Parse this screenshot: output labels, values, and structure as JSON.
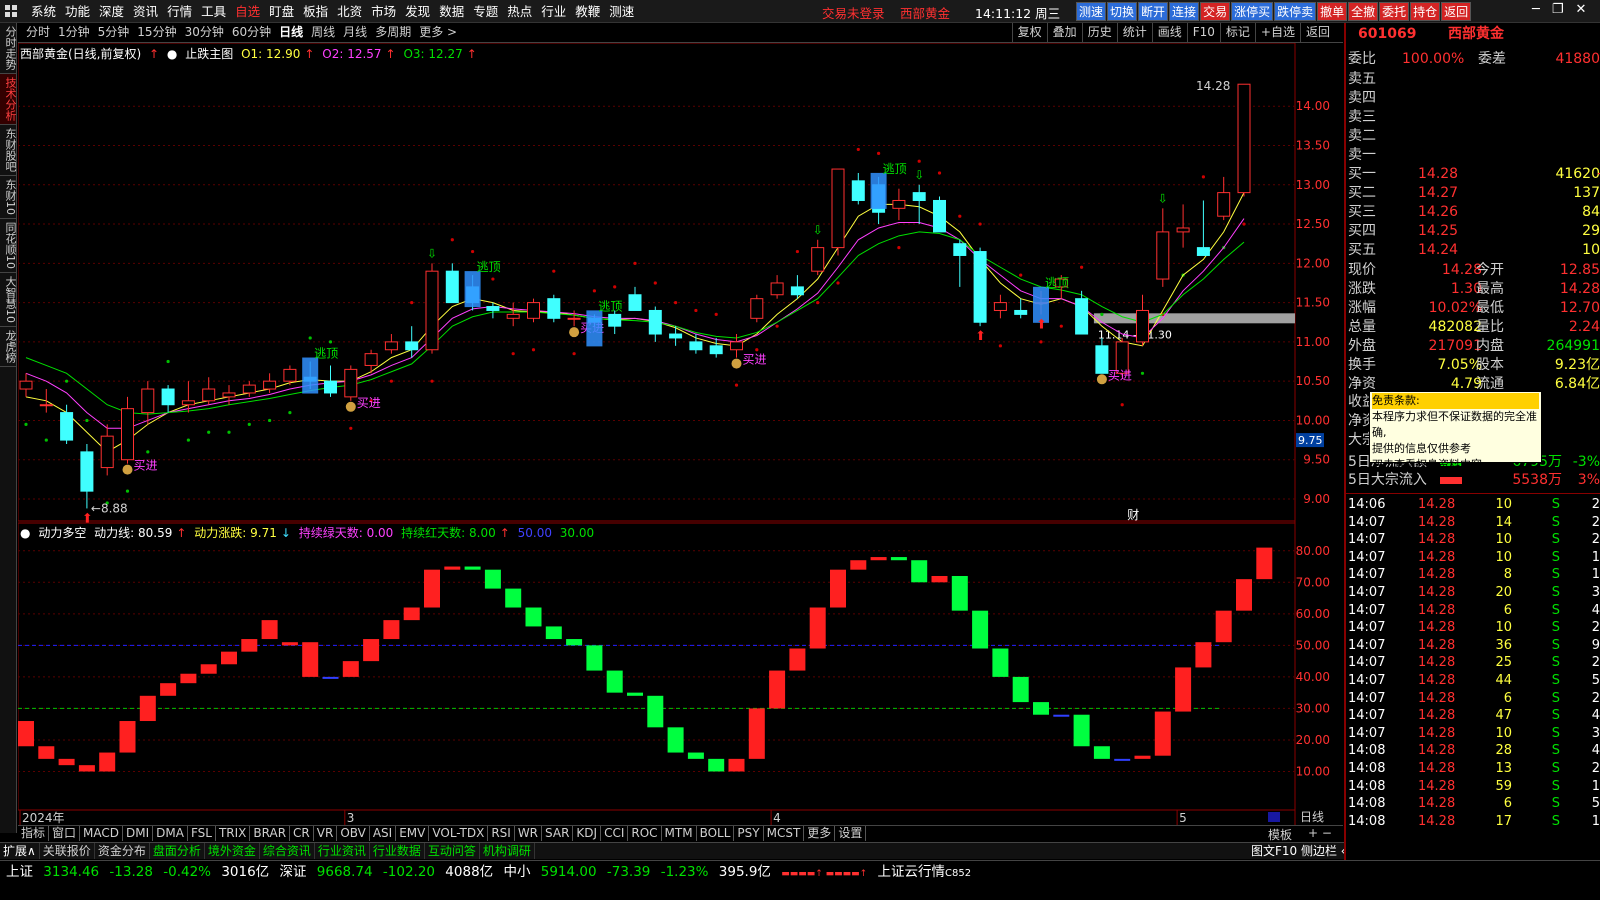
{
  "menu": {
    "items": [
      "系统",
      "功能",
      "深度",
      "资讯",
      "行情",
      "工具",
      "自选",
      "盯盘",
      "板指",
      "北资",
      "市场",
      "发现",
      "数据",
      "专题",
      "热点",
      "行业",
      "教鞭",
      "测速"
    ],
    "active": "自选",
    "login_status": "交易未登录",
    "stock_name_top": "西部黄金",
    "time": "14:11:12",
    "weekday": "周三",
    "quick_buttons": [
      {
        "label": "测速",
        "c": "blue"
      },
      {
        "label": "切换",
        "c": "blue"
      },
      {
        "label": "断开",
        "c": "blue"
      },
      {
        "label": "连接",
        "c": "blue"
      },
      {
        "label": "交易",
        "c": "red"
      },
      {
        "label": "涨停买",
        "c": "blue"
      },
      {
        "label": "跌停卖",
        "c": "blue"
      },
      {
        "label": "撤单",
        "c": "red"
      },
      {
        "label": "全撤",
        "c": "red"
      },
      {
        "label": "委托",
        "c": "red"
      },
      {
        "label": "持仓",
        "c": "red"
      },
      {
        "label": "返回",
        "c": "red"
      }
    ]
  },
  "left_tabs": [
    {
      "label": "分时走势",
      "active": false
    },
    {
      "label": "技术分析",
      "active": true
    },
    {
      "label": "东财股吧",
      "active": false
    },
    {
      "label": "东财10",
      "active": false
    },
    {
      "label": "同花顺10",
      "active": false
    },
    {
      "label": "大智慧10",
      "active": false
    },
    {
      "label": "龙虎榜",
      "active": false
    }
  ],
  "period_bar": {
    "periods": [
      "分时",
      "1分钟",
      "5分钟",
      "15分钟",
      "30分钟",
      "60分钟",
      "日线",
      "周线",
      "月线",
      "多周期",
      "更多 >"
    ],
    "active": "日线",
    "tools": [
      "复权",
      "叠加",
      "历史",
      "统计",
      "画线",
      "F10",
      "标记",
      "+自选",
      "返回"
    ]
  },
  "main_chart_title": {
    "name": "西部黄金(日线,前复权)",
    "indicator": "止跌主图",
    "o1": "O1: 12.90",
    "o2": "O2: 12.57",
    "o3": "O3: 12.27"
  },
  "indicator_title": {
    "name": "动力多空",
    "l1": "动力线: 80.59",
    "l2": "动力涨跌: 9.71",
    "l3": "持续绿天数: 0.00",
    "l4": "持续红天数: 8.00",
    "l5": "50.00",
    "l6": "30.00"
  },
  "chart_data": {
    "type": "candlestick",
    "price_axis": {
      "min": 9.0,
      "max": 14.0,
      "ticks": [
        "14.00",
        "13.50",
        "13.00",
        "12.50",
        "12.00",
        "11.50",
        "11.00",
        "10.50",
        "10.00",
        "9.50",
        "9.00"
      ]
    },
    "x_labels": [
      {
        "label": "2024年",
        "i": 0
      },
      {
        "label": "3",
        "i": 16
      },
      {
        "label": "4",
        "i": 37
      },
      {
        "label": "5",
        "i": 57
      }
    ],
    "candles": [
      [
        10.4,
        10.6,
        10.3,
        10.5
      ],
      [
        10.2,
        10.4,
        10.1,
        10.2
      ],
      [
        10.1,
        10.2,
        9.7,
        9.75
      ],
      [
        9.6,
        9.7,
        8.88,
        9.1
      ],
      [
        9.4,
        9.95,
        9.3,
        9.8
      ],
      [
        9.5,
        10.3,
        9.45,
        10.15
      ],
      [
        10.1,
        10.5,
        9.95,
        10.4
      ],
      [
        10.4,
        10.45,
        10.1,
        10.2
      ],
      [
        10.2,
        10.5,
        10.1,
        10.25
      ],
      [
        10.25,
        10.55,
        10.2,
        10.4
      ],
      [
        10.3,
        10.45,
        10.2,
        10.35
      ],
      [
        10.35,
        10.5,
        10.3,
        10.45
      ],
      [
        10.4,
        10.6,
        10.35,
        10.5
      ],
      [
        10.5,
        10.7,
        10.45,
        10.65
      ],
      [
        10.55,
        10.75,
        10.4,
        10.5
      ],
      [
        10.5,
        10.7,
        10.3,
        10.35
      ],
      [
        10.3,
        10.7,
        10.25,
        10.65
      ],
      [
        10.7,
        10.9,
        10.6,
        10.85
      ],
      [
        10.9,
        11.1,
        10.85,
        11.0
      ],
      [
        11.0,
        11.2,
        10.8,
        10.9
      ],
      [
        10.9,
        12.0,
        10.85,
        11.9
      ],
      [
        11.9,
        12.0,
        11.5,
        11.5
      ],
      [
        11.7,
        11.85,
        11.4,
        11.5
      ],
      [
        11.45,
        11.5,
        11.3,
        11.4
      ],
      [
        11.3,
        11.5,
        11.2,
        11.35
      ],
      [
        11.3,
        11.55,
        11.25,
        11.5
      ],
      [
        11.55,
        11.6,
        11.25,
        11.3
      ],
      [
        11.3,
        11.4,
        11.2,
        11.3
      ],
      [
        11.3,
        11.35,
        11.2,
        11.25
      ],
      [
        11.35,
        11.4,
        11.1,
        11.2
      ],
      [
        11.6,
        11.7,
        11.4,
        11.4
      ],
      [
        11.4,
        11.45,
        11.0,
        11.1
      ],
      [
        11.1,
        11.2,
        10.95,
        11.05
      ],
      [
        11.0,
        11.1,
        10.85,
        10.9
      ],
      [
        10.95,
        11.05,
        10.8,
        10.85
      ],
      [
        10.9,
        11.1,
        10.8,
        11.0
      ],
      [
        11.3,
        11.6,
        11.25,
        11.55
      ],
      [
        11.6,
        11.85,
        11.55,
        11.75
      ],
      [
        11.7,
        11.85,
        11.55,
        11.6
      ],
      [
        11.9,
        12.3,
        11.85,
        12.2
      ],
      [
        12.2,
        13.2,
        12.1,
        13.2
      ],
      [
        13.05,
        13.15,
        12.75,
        12.8
      ],
      [
        13.0,
        13.1,
        12.5,
        12.65
      ],
      [
        12.7,
        12.95,
        12.55,
        12.8
      ],
      [
        12.9,
        13.0,
        12.5,
        12.8
      ],
      [
        12.8,
        12.85,
        12.4,
        12.4
      ],
      [
        12.25,
        12.3,
        11.7,
        12.1
      ],
      [
        12.15,
        12.2,
        11.2,
        11.25
      ],
      [
        11.4,
        11.6,
        11.3,
        11.5
      ],
      [
        11.4,
        11.55,
        11.3,
        11.35
      ],
      [
        11.5,
        11.65,
        11.35,
        11.5
      ],
      [
        11.7,
        11.85,
        11.55,
        11.8
      ],
      [
        11.55,
        11.65,
        11.1,
        11.1
      ],
      [
        10.95,
        11.05,
        10.6,
        10.6
      ],
      [
        10.6,
        11.05,
        10.55,
        11.0
      ],
      [
        11.0,
        11.6,
        10.95,
        11.4
      ],
      [
        11.8,
        12.7,
        11.7,
        12.4
      ],
      [
        12.4,
        12.75,
        12.2,
        12.45
      ],
      [
        12.2,
        12.8,
        12.1,
        12.1
      ],
      [
        12.6,
        13.1,
        12.55,
        12.9
      ],
      [
        12.9,
        14.28,
        12.85,
        14.28
      ]
    ],
    "ma": [
      {
        "name": "O1",
        "color": "#ffff40",
        "values": [
          10.3,
          10.25,
          10.1,
          9.85,
          9.6,
          9.75,
          9.95,
          10.1,
          10.2,
          10.25,
          10.3,
          10.35,
          10.4,
          10.48,
          10.52,
          10.5,
          10.5,
          10.62,
          10.8,
          10.9,
          11.2,
          11.45,
          11.55,
          11.5,
          11.4,
          11.38,
          11.38,
          11.34,
          11.3,
          11.28,
          11.3,
          11.26,
          11.18,
          11.05,
          10.98,
          10.95,
          11.1,
          11.35,
          11.55,
          11.8,
          12.2,
          12.6,
          12.75,
          12.75,
          12.72,
          12.6,
          12.4,
          12.05,
          11.75,
          11.55,
          11.48,
          11.55,
          11.45,
          11.2,
          11.0,
          10.95,
          11.4,
          11.85,
          12.05,
          12.4,
          12.9
        ]
      },
      {
        "name": "O2",
        "color": "#ff40ff",
        "values": [
          10.6,
          10.5,
          10.35,
          10.1,
          9.9,
          9.9,
          10.0,
          10.1,
          10.15,
          10.2,
          10.25,
          10.28,
          10.33,
          10.4,
          10.45,
          10.48,
          10.5,
          10.58,
          10.7,
          10.8,
          11.05,
          11.3,
          11.42,
          11.45,
          11.42,
          11.4,
          11.38,
          11.36,
          11.32,
          11.3,
          11.3,
          11.27,
          11.2,
          11.1,
          11.03,
          11.0,
          11.08,
          11.25,
          11.42,
          11.62,
          11.95,
          12.3,
          12.45,
          12.52,
          12.52,
          12.45,
          12.3,
          12.05,
          11.85,
          11.65,
          11.55,
          11.55,
          11.45,
          11.25,
          11.1,
          11.05,
          11.3,
          11.65,
          11.9,
          12.2,
          12.57
        ]
      },
      {
        "name": "O3",
        "color": "#00e000",
        "values": [
          10.8,
          10.7,
          10.6,
          10.4,
          10.2,
          10.1,
          10.08,
          10.1,
          10.12,
          10.15,
          10.2,
          10.24,
          10.28,
          10.33,
          10.38,
          10.42,
          10.45,
          10.52,
          10.62,
          10.72,
          10.95,
          11.2,
          11.32,
          11.38,
          11.38,
          11.38,
          11.36,
          11.34,
          11.3,
          11.28,
          11.27,
          11.25,
          11.2,
          11.12,
          11.07,
          11.05,
          11.12,
          11.25,
          11.4,
          11.55,
          11.82,
          12.1,
          12.25,
          12.35,
          12.4,
          12.38,
          12.3,
          12.1,
          11.95,
          11.8,
          11.7,
          11.66,
          11.6,
          11.45,
          11.32,
          11.25,
          11.35,
          11.6,
          11.8,
          12.05,
          12.27
        ]
      }
    ],
    "annotations": {
      "high_label": "14.28",
      "low_label": "8.88",
      "zone_label": "11.14 - 11.30",
      "cursor_price": "9.75",
      "buy_label": "买进",
      "top_label": "逃顶",
      "fin_label": "财"
    },
    "indicator": {
      "axis": {
        "min": 0,
        "max": 85,
        "ticks": [
          "80.00",
          "70.00",
          "60.00",
          "50.00",
          "40.00",
          "30.00",
          "20.00",
          "10.00"
        ]
      },
      "lines": [
        50,
        30
      ],
      "values": [
        [
          18,
          26
        ],
        [
          14,
          18
        ],
        [
          12,
          14
        ],
        [
          10,
          12
        ],
        [
          10,
          16
        ],
        [
          16,
          26
        ],
        [
          26,
          34
        ],
        [
          34,
          38
        ],
        [
          38,
          41
        ],
        [
          41,
          44
        ],
        [
          44,
          48
        ],
        [
          48,
          52
        ],
        [
          52,
          58
        ],
        [
          50,
          51
        ],
        [
          40,
          51
        ],
        [
          40,
          40
        ],
        [
          40,
          45
        ],
        [
          45,
          52
        ],
        [
          52,
          58
        ],
        [
          58,
          62
        ],
        [
          62,
          74
        ],
        [
          74,
          75
        ],
        [
          75,
          74
        ],
        [
          74,
          68
        ],
        [
          68,
          62
        ],
        [
          62,
          56
        ],
        [
          56,
          52
        ],
        [
          52,
          50
        ],
        [
          50,
          42
        ],
        [
          42,
          35
        ],
        [
          35,
          34
        ],
        [
          34,
          24
        ],
        [
          24,
          16
        ],
        [
          16,
          14
        ],
        [
          14,
          10
        ],
        [
          10,
          14
        ],
        [
          14,
          30
        ],
        [
          30,
          42
        ],
        [
          42,
          49
        ],
        [
          49,
          62
        ],
        [
          62,
          74
        ],
        [
          74,
          77
        ],
        [
          77,
          78
        ],
        [
          78,
          77
        ],
        [
          77,
          70
        ],
        [
          70,
          72
        ],
        [
          72,
          61
        ],
        [
          61,
          49
        ],
        [
          49,
          40
        ],
        [
          40,
          32
        ],
        [
          32,
          28
        ],
        [
          28,
          28
        ],
        [
          28,
          18
        ],
        [
          18,
          14
        ],
        [
          14,
          14
        ],
        [
          14,
          15
        ],
        [
          15,
          29
        ],
        [
          29,
          43
        ],
        [
          43,
          51
        ],
        [
          51,
          61
        ],
        [
          61,
          71
        ],
        [
          71,
          81
        ]
      ]
    }
  },
  "right_panel": {
    "code": "601069",
    "name": "西部黄金",
    "weibi_label": "委比",
    "weibi": "100.00%",
    "weicha_label": "委差",
    "weicha": "41880",
    "sells": [
      "卖五",
      "卖四",
      "卖三",
      "卖二",
      "卖一"
    ],
    "buys": [
      {
        "label": "买一",
        "price": "14.28",
        "vol": "41620"
      },
      {
        "label": "买二",
        "price": "14.27",
        "vol": "137"
      },
      {
        "label": "买三",
        "price": "14.26",
        "vol": "84"
      },
      {
        "label": "买四",
        "price": "14.25",
        "vol": "29"
      },
      {
        "label": "买五",
        "price": "14.24",
        "vol": "10"
      }
    ],
    "stats": [
      {
        "l1": "现价",
        "v1": "14.28",
        "c1": "r",
        "l2": "今开",
        "v2": "12.85",
        "c2": "r"
      },
      {
        "l1": "涨跌",
        "v1": "1.30",
        "c1": "r",
        "l2": "最高",
        "v2": "14.28",
        "c2": "r"
      },
      {
        "l1": "涨幅",
        "v1": "10.02%",
        "c1": "r",
        "l2": "最低",
        "v2": "12.70",
        "c2": "r"
      },
      {
        "l1": "总量",
        "v1": "482082",
        "c1": "y",
        "l2": "量比",
        "v2": "2.24",
        "c2": "r"
      },
      {
        "l1": "外盘",
        "v1": "217091",
        "c1": "r",
        "l2": "内盘",
        "v2": "264991",
        "c2": "g"
      },
      {
        "l1": "换手",
        "v1": "7.05%",
        "c1": "y",
        "l2": "股本",
        "v2": "9.23亿",
        "c2": "y"
      },
      {
        "l1": "净资",
        "v1": "4.79",
        "c1": "y",
        "l2": "流通",
        "v2": "6.84亿",
        "c2": "y"
      }
    ],
    "partial_rows": [
      {
        "l": "收益"
      },
      {
        "l": "净资"
      },
      {
        "l": "大宗"
      }
    ],
    "flow": [
      {
        "label": "5日净流入额",
        "val": "-6795万",
        "pct": "-3%"
      },
      {
        "label": "5日大宗流入",
        "val": "5538万",
        "pct": "3%"
      }
    ],
    "ticks": [
      [
        "14:06",
        "14.28",
        "10",
        "S",
        "2"
      ],
      [
        "14:07",
        "14.28",
        "14",
        "S",
        "2"
      ],
      [
        "14:07",
        "14.28",
        "10",
        "S",
        "2"
      ],
      [
        "14:07",
        "14.28",
        "10",
        "S",
        "1"
      ],
      [
        "14:07",
        "14.28",
        "8",
        "S",
        "1"
      ],
      [
        "14:07",
        "14.28",
        "20",
        "S",
        "3"
      ],
      [
        "14:07",
        "14.28",
        "6",
        "S",
        "4"
      ],
      [
        "14:07",
        "14.28",
        "10",
        "S",
        "2"
      ],
      [
        "14:07",
        "14.28",
        "36",
        "S",
        "9"
      ],
      [
        "14:07",
        "14.28",
        "25",
        "S",
        "2"
      ],
      [
        "14:07",
        "14.28",
        "44",
        "S",
        "5"
      ],
      [
        "14:07",
        "14.28",
        "6",
        "S",
        "2"
      ],
      [
        "14:07",
        "14.28",
        "47",
        "S",
        "4"
      ],
      [
        "14:07",
        "14.28",
        "10",
        "S",
        "3"
      ],
      [
        "14:08",
        "14.28",
        "28",
        "S",
        "4"
      ],
      [
        "14:08",
        "14.28",
        "13",
        "S",
        "2"
      ],
      [
        "14:08",
        "14.28",
        "59",
        "S",
        "1"
      ],
      [
        "14:08",
        "14.28",
        "6",
        "S",
        "5"
      ],
      [
        "14:08",
        "14.28",
        "17",
        "S",
        "1"
      ]
    ],
    "bottom_tabs": [
      "笔",
      "价",
      "细",
      "势",
      "联",
      "值",
      "主",
      "筹"
    ]
  },
  "tooltip": {
    "title": "免责条款:",
    "lines": [
      "本程序力求但不保证数据的完全准确,",
      "提供的信息仅供参考",
      "双击查看权息资料内容"
    ]
  },
  "bottom_tabs": [
    "指标",
    "窗口",
    "MACD",
    "DMI",
    "DMA",
    "FSL",
    "TRIX",
    "BRAR",
    "CR",
    "VR",
    "OBV",
    "ASI",
    "EMV",
    "VOL-TDX",
    "RSI",
    "WR",
    "SAR",
    "KDJ",
    "CCI",
    "ROC",
    "MTM",
    "BOLL",
    "PSY",
    "MCST",
    "更多",
    "设置"
  ],
  "bottom_right": {
    "period": "日线",
    "template": "模板"
  },
  "ext_tabs": [
    "扩展∧",
    "关联报价",
    "资金分布",
    "盘面分析",
    "境外资金",
    "综合资讯",
    "行业资讯",
    "行业数据",
    "互动问答",
    "机构调研"
  ],
  "ext_right": "图文F10 侧边栏 «",
  "ticker": {
    "sh_label": "上证",
    "sh": "3134.46",
    "sh_chg": "-13.28",
    "sh_pct": "-0.42%",
    "sh_amt": "3016亿",
    "sz_label": "深证",
    "sz": "9668.74",
    "sz_chg": "-102.20",
    "sz_amt": "4088亿",
    "zx_label": "中小",
    "zx": "5914.00",
    "zx_chg": "-73.39",
    "zx_pct": "-1.23%",
    "zx_amt": "395.9亿",
    "cloud": "上证云行情",
    "cloud_code": "C852"
  }
}
